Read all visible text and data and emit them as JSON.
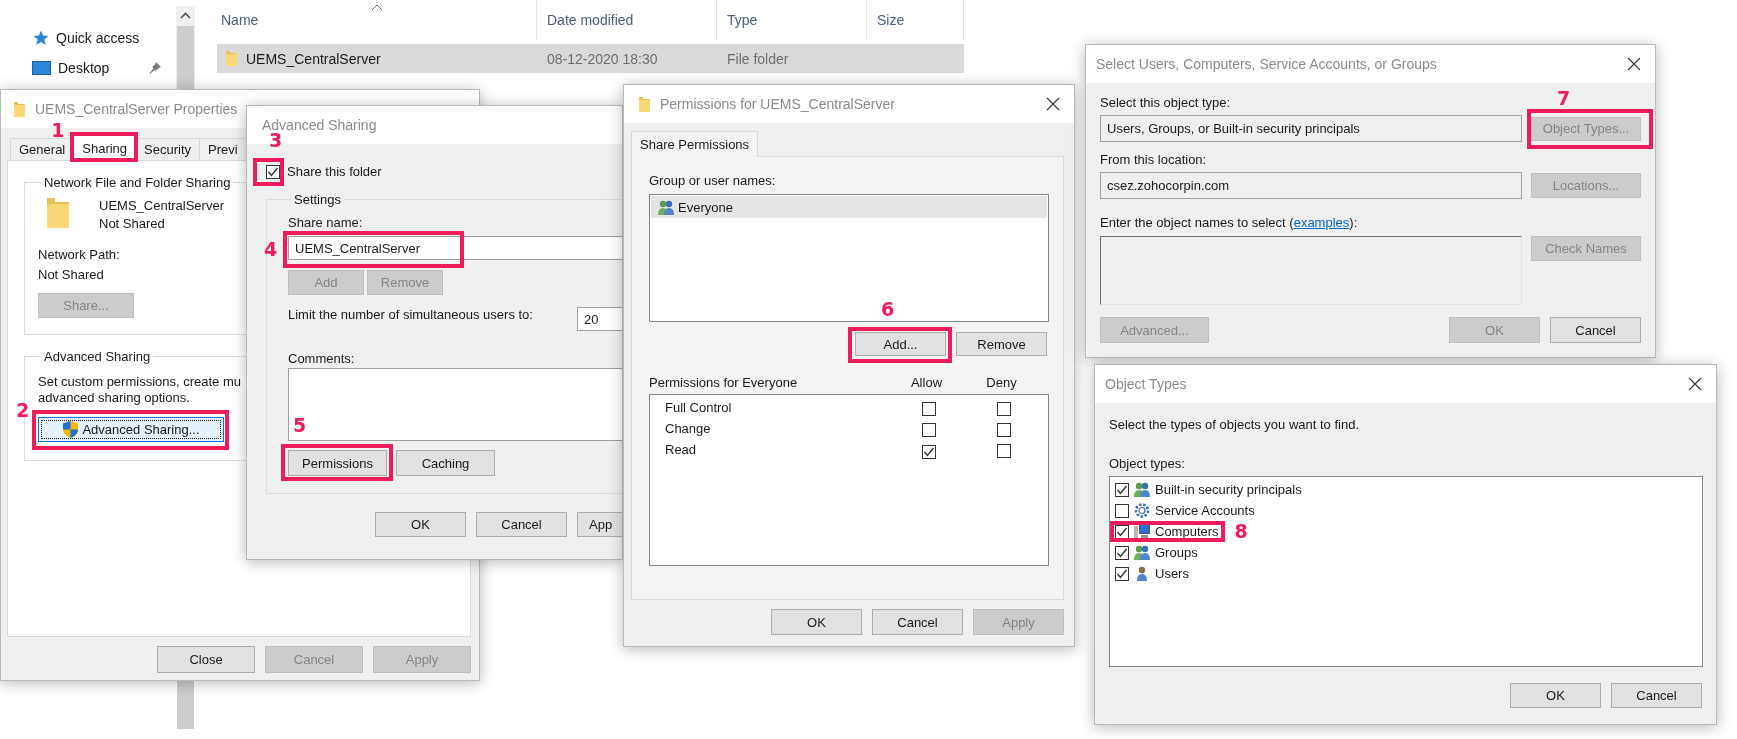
{
  "explorer": {
    "nav_items": [
      {
        "label": "Quick access",
        "kind": "star",
        "pinned": false
      },
      {
        "label": "Desktop",
        "kind": "desktop",
        "pinned": true
      }
    ],
    "columns": [
      {
        "label": "Name",
        "sorted": true
      },
      {
        "label": "Date modified",
        "sorted": false
      },
      {
        "label": "Type",
        "sorted": false
      },
      {
        "label": "Size",
        "sorted": false
      }
    ],
    "rows": [
      {
        "name": "UEMS_CentralServer",
        "date_modified": "08-12-2020 18:30",
        "type": "File folder",
        "selected": true
      }
    ]
  },
  "properties": {
    "title": "UEMS_CentralServer Properties",
    "tabs": [
      {
        "label": "General",
        "selected": false
      },
      {
        "label": "Sharing",
        "selected": true,
        "step": "1"
      },
      {
        "label": "Security",
        "selected": false
      },
      {
        "label": "Previ",
        "selected": false
      }
    ],
    "network_sharing": {
      "title": "Network File and Folder Sharing",
      "folder_name": "UEMS_CentralServer",
      "folder_status": "Not Shared",
      "path_label": "Network Path:",
      "path_value": "Not Shared",
      "share_button": {
        "label": "Share...",
        "disabled": true
      }
    },
    "advanced_sharing": {
      "title": "Advanced Sharing",
      "description_lines": [
        "Set custom permissions, create mu",
        "advanced sharing options."
      ],
      "button": {
        "label": "Advanced Sharing...",
        "disabled": false,
        "focused": true,
        "step": "2"
      }
    },
    "buttons": [
      {
        "label": "Close",
        "disabled": false
      },
      {
        "label": "Cancel",
        "disabled": true
      },
      {
        "label": "Apply",
        "disabled": true
      }
    ]
  },
  "advanced_sharing_dialog": {
    "title": "Advanced Sharing",
    "share_checkbox": {
      "label": "Share this folder",
      "checked": true,
      "step": "3"
    },
    "settings_title": "Settings",
    "share_name": {
      "label": "Share name:",
      "value": "UEMS_CentralServer",
      "step": "4"
    },
    "name_buttons": [
      {
        "label": "Add",
        "disabled": true
      },
      {
        "label": "Remove",
        "disabled": true
      }
    ],
    "user_limit": {
      "label": "Limit the number of simultaneous users to:",
      "value": "20"
    },
    "comments": {
      "label": "Comments:"
    },
    "setting_buttons": [
      {
        "label": "Permissions",
        "disabled": false,
        "step": "5"
      },
      {
        "label": "Caching",
        "disabled": false
      }
    ],
    "buttons": [
      {
        "label": "OK",
        "disabled": false
      },
      {
        "label": "Cancel",
        "disabled": false
      },
      {
        "label": "App",
        "disabled": false
      }
    ]
  },
  "permissions_dialog": {
    "title": "Permissions for UEMS_CentralServer",
    "tabs": [
      {
        "label": "Share Permissions",
        "selected": true
      }
    ],
    "users_label": "Group or user names:",
    "users": [
      {
        "name": "Everyone",
        "selected": true
      }
    ],
    "user_buttons": [
      {
        "label": "Add...",
        "disabled": false,
        "step": "6"
      },
      {
        "label": "Remove",
        "disabled": false
      }
    ],
    "permissions_label": "Permissions for Everyone",
    "allow_label": "Allow",
    "deny_label": "Deny",
    "permissions": [
      {
        "name": "Full Control",
        "allow": false,
        "deny": false
      },
      {
        "name": "Change",
        "allow": false,
        "deny": false
      },
      {
        "name": "Read",
        "allow": true,
        "deny": false
      }
    ],
    "buttons": [
      {
        "label": "OK",
        "disabled": false
      },
      {
        "label": "Cancel",
        "disabled": false
      },
      {
        "label": "Apply",
        "disabled": true
      }
    ]
  },
  "select_dialog": {
    "title": "Select Users, Computers, Service Accounts, or Groups",
    "object_type_label": "Select this object type:",
    "object_type_value": "Users, Groups, or Built-in security principals",
    "object_types_button": {
      "label": "Object Types...",
      "disabled": true,
      "step": "7"
    },
    "location_label": "From this location:",
    "location_value": "csez.zohocorpin.com",
    "locations_button": {
      "label": "Locations...",
      "disabled": true
    },
    "names_label_before": "Enter the object names to select (",
    "names_link": "examples",
    "names_label_after": "):",
    "check_names_button": {
      "label": "Check Names",
      "disabled": true
    },
    "buttons": [
      {
        "label": "Advanced...",
        "disabled": true
      },
      {
        "label": "OK",
        "disabled": true
      },
      {
        "label": "Cancel",
        "disabled": false
      }
    ]
  },
  "object_types_dialog": {
    "title": "Object Types",
    "prompt": "Select the types of objects you want to find.",
    "list_label": "Object types:",
    "items": [
      {
        "label": "Built-in security principals",
        "kind": "principals",
        "checked": true
      },
      {
        "label": "Service Accounts",
        "kind": "service",
        "checked": false
      },
      {
        "label": "Computers",
        "kind": "computer",
        "checked": true,
        "step": "8"
      },
      {
        "label": "Groups",
        "kind": "group",
        "checked": true
      },
      {
        "label": "Users",
        "kind": "user",
        "checked": true
      }
    ],
    "buttons": [
      {
        "label": "OK",
        "disabled": false
      },
      {
        "label": "Cancel",
        "disabled": false
      }
    ]
  }
}
